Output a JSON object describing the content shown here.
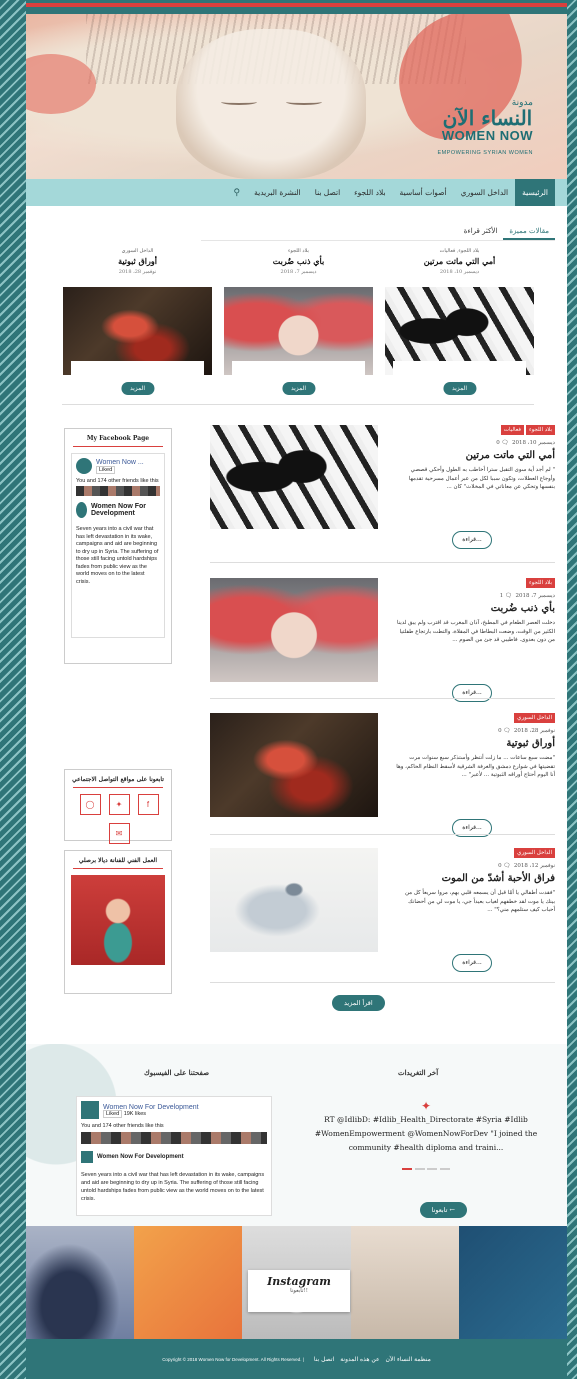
{
  "logo": {
    "ar_small": "مدونة",
    "ar_big": "النساء الآن",
    "en": "WOMEN NOW",
    "tagline": "EMPOWERING SYRIAN WOMEN"
  },
  "nav": {
    "items": [
      "الرئيسية",
      "الداخل السوري",
      "أصوات أساسية",
      "بلاد اللجوء",
      "اتصل بنا",
      "النشرة البريدية"
    ],
    "search_icon": "search-icon"
  },
  "tabs": [
    "مقالات مميزة",
    "الأكثر قراءة"
  ],
  "featured": [
    {
      "cat": "بلاد اللجوء, فعاليات",
      "title": "أمي التي ماتت مرتين",
      "date": "ديسمبر 10، 2018",
      "more": "المزيد"
    },
    {
      "cat": "بلاد اللجوء",
      "title": "بأي ذنب ضُربت",
      "date": "ديسمبر 7، 2018",
      "more": "المزيد"
    },
    {
      "cat": "الداخل السوري",
      "title": "أوراق ثبوتية",
      "date": "نوفمبر 28، 2018",
      "more": "المزيد"
    }
  ],
  "posts": [
    {
      "cats": [
        "بلاد اللجوء",
        "فعاليات"
      ],
      "date": "ديسمبر 10، 2018",
      "comments": "0",
      "title": "أمي التي ماتت مرتين",
      "excerpt": "\" لم أجد أية سوى التقبل سترا أخاطب به الطول وأحكي قصصي وأوجاع العطلات، وتكون سببا لكل من عبر أعمال مسرحية تقدمها بنفسها وتحكي عن معاناتي في المخلاث\" كان ...",
      "read": "قراءة..."
    },
    {
      "cats": [
        "بلاد اللجوء"
      ],
      "date": "ديسمبر 7، 2018",
      "comments": "1",
      "title": "بأي ذنب ضُربت",
      "excerpt": "دخلت العصر الطعام في المطبخ، آذان المغرب قد اقترب ولم يبق لدينا الكثير من الوقت، وضعت البطاطا في المقلاة، والتطت بارتجاع طفلتيا من دون بعدوى. فاطيبي قد جئ من الصوم ...",
      "read": "قراءة..."
    },
    {
      "cats": [
        "الداخل السوري"
      ],
      "date": "نوفمبر 28، 2018",
      "comments": "0",
      "title": "أوراق ثبوتية",
      "excerpt": "\"مضت سبع ساعات ... ما زلت أنتظر وأستذكر سبع سنوات مرت تقضيتها في شوارع دمشق والغرفة الشرقية لأسقط النظام الحاكم، وها أنا اليوم أحتاج أوراقه الثبوتية ... لأعبر\" ...",
      "read": "قراءة..."
    },
    {
      "cats": [
        "الداخل السوري"
      ],
      "date": "نوفمبر 12، 2018",
      "comments": "0",
      "title": "فراق الأحبة أشدّ من الموت",
      "excerpt": "\"فقدت أطفالي يا أمّا قبل أن يسمعه قلبي بهم، مروا سريعاً كل من بينك يا موت لقد خطفهم لغياب بعيداً جي، يا موت لي من أحضانك أحباب كيف ستلمهم مني؟\" ...",
      "read": "قراءة..."
    }
  ],
  "load_more": "اقرأ المزيد",
  "sidebar": {
    "fb_title": "My Facebook Page",
    "fb_name": "Women Now ...",
    "fb_liked": "Liked",
    "fb_friends": "You and 174 other friends like this",
    "fb_post_name": "Women Now For Development",
    "fb_post_text": "Seven years into a civil war that has left devastation in its wake, campaigns and aid are beginning to dry up in Syria. The suffering of those still facing untold hardships fades from public view as the world moves on to the latest crisis.",
    "social_title": "تابعونا على مواقع التواصل الاجتماعي",
    "social_icons": [
      "instagram-icon",
      "twitter-icon",
      "facebook-icon",
      "email-icon"
    ],
    "art_title": "العمل الفني للفنانة ديالا برصلي"
  },
  "bottom": {
    "fb_col_title": "صفحتنا على الفيسبوك",
    "fb_name": "Women Now For Development",
    "fb_likes": "19K likes",
    "fb_liked": "Liked",
    "fb_friends": "You and 174 other friends like this",
    "fb_post_name": "Women Now For Development",
    "fb_post_text": "Seven years into a civil war that has left devastation in its wake, campaigns and aid are beginning to dry up in Syria. The suffering of those still facing untold hardships fades from public view as the world moves on to the latest crisis.",
    "tw_col_title": "آخر التغريدات",
    "tweet_line1": "RT @IdlibD: #Idlib_Health_Directorate #Syria #Idlib",
    "tweet_line2": "#WomenEmpowerment @WomenNowForDev \"I joined the",
    "tweet_line3": "community #health diploma and traini...",
    "follow": "تابعونا ←"
  },
  "instagram": {
    "title": "Instagram",
    "subtitle": "تابعونا!!"
  },
  "footer": {
    "copyright": "Copyright © 2018 Women Now for Development. All Rights Reserved. |",
    "links": [
      "منظمة النساء الآن",
      "عن هذه المدونة",
      "اتصل بنا"
    ]
  }
}
